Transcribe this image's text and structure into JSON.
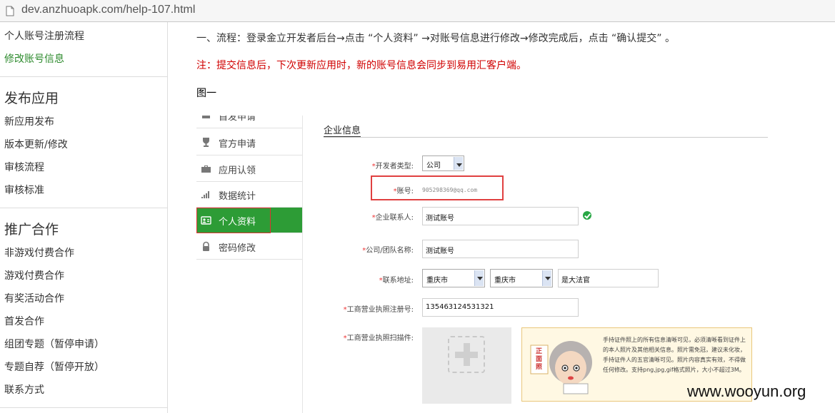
{
  "browser": {
    "url": "dev.anzhuoapk.com/help-107.html"
  },
  "sidebar": {
    "top_links": [
      "个人账号注册流程",
      "修改账号信息"
    ],
    "sections": [
      {
        "heading": "发布应用",
        "items": [
          "新应用发布",
          "版本更新/修改",
          "审核流程",
          "审核标准"
        ]
      },
      {
        "heading": "推广合作",
        "items": [
          "非游戏付费合作",
          "游戏付费合作",
          "有奖活动合作",
          "首发合作",
          "组团专题（暂停申请）",
          "专题自荐（暂停开放）",
          "联系方式"
        ]
      }
    ]
  },
  "main": {
    "flow_text": "一、流程：登录金立开发者后台→点击 “个人资料” →对账号信息进行修改→修改完成后，点击 “确认提交” 。",
    "note_text": "注：提交信息后，下次更新应用时，新的账号信息会同步到易用汇客户端。",
    "figure_label": "图一"
  },
  "screenshot": {
    "menu": [
      {
        "label": "首发申请",
        "icon": "crown-icon"
      },
      {
        "label": "官方申请",
        "icon": "trophy-icon"
      },
      {
        "label": "应用认领",
        "icon": "briefcase-icon"
      },
      {
        "label": "数据统计",
        "icon": "bar-chart-icon"
      },
      {
        "label": "个人资料",
        "icon": "id-card-icon"
      },
      {
        "label": "密码修改",
        "icon": "lock-icon"
      }
    ],
    "active_menu_index": 4,
    "tab_title": "企业信息",
    "form": {
      "developer_type": {
        "label": "开发者类型:",
        "value": "公司"
      },
      "account": {
        "label": "账号:",
        "value": "905298369@qq.com"
      },
      "contact": {
        "label": "企业联系人:",
        "value": "测试账号"
      },
      "company": {
        "label": "公司/团队名称:",
        "value": "测试账号"
      },
      "address": {
        "label": "联系地址:",
        "province": "重庆市",
        "city": "重庆市",
        "detail": "是大法官"
      },
      "license_no": {
        "label": "工商营业执照注册号:",
        "value": "135463124531321"
      },
      "license_scan": {
        "label": "工商营业执照扫描件:"
      }
    },
    "tip": {
      "stamp": "正面照",
      "text": "手持证件照上的所有信息清晰可见，必须清晰看到证件上的本人照片及其他相关信息。照片需免冠，建议未化妆，手持证件人的五官清晰可见。照片内容真实有效，不得做任何修改。支持png,jpg,gif格式照片，大小不超过3M。"
    }
  },
  "watermark": "www.wooyun.org",
  "colors": {
    "accent_green": "#2d9c36",
    "note_red": "#d00000",
    "highlight_red": "#e04040"
  }
}
